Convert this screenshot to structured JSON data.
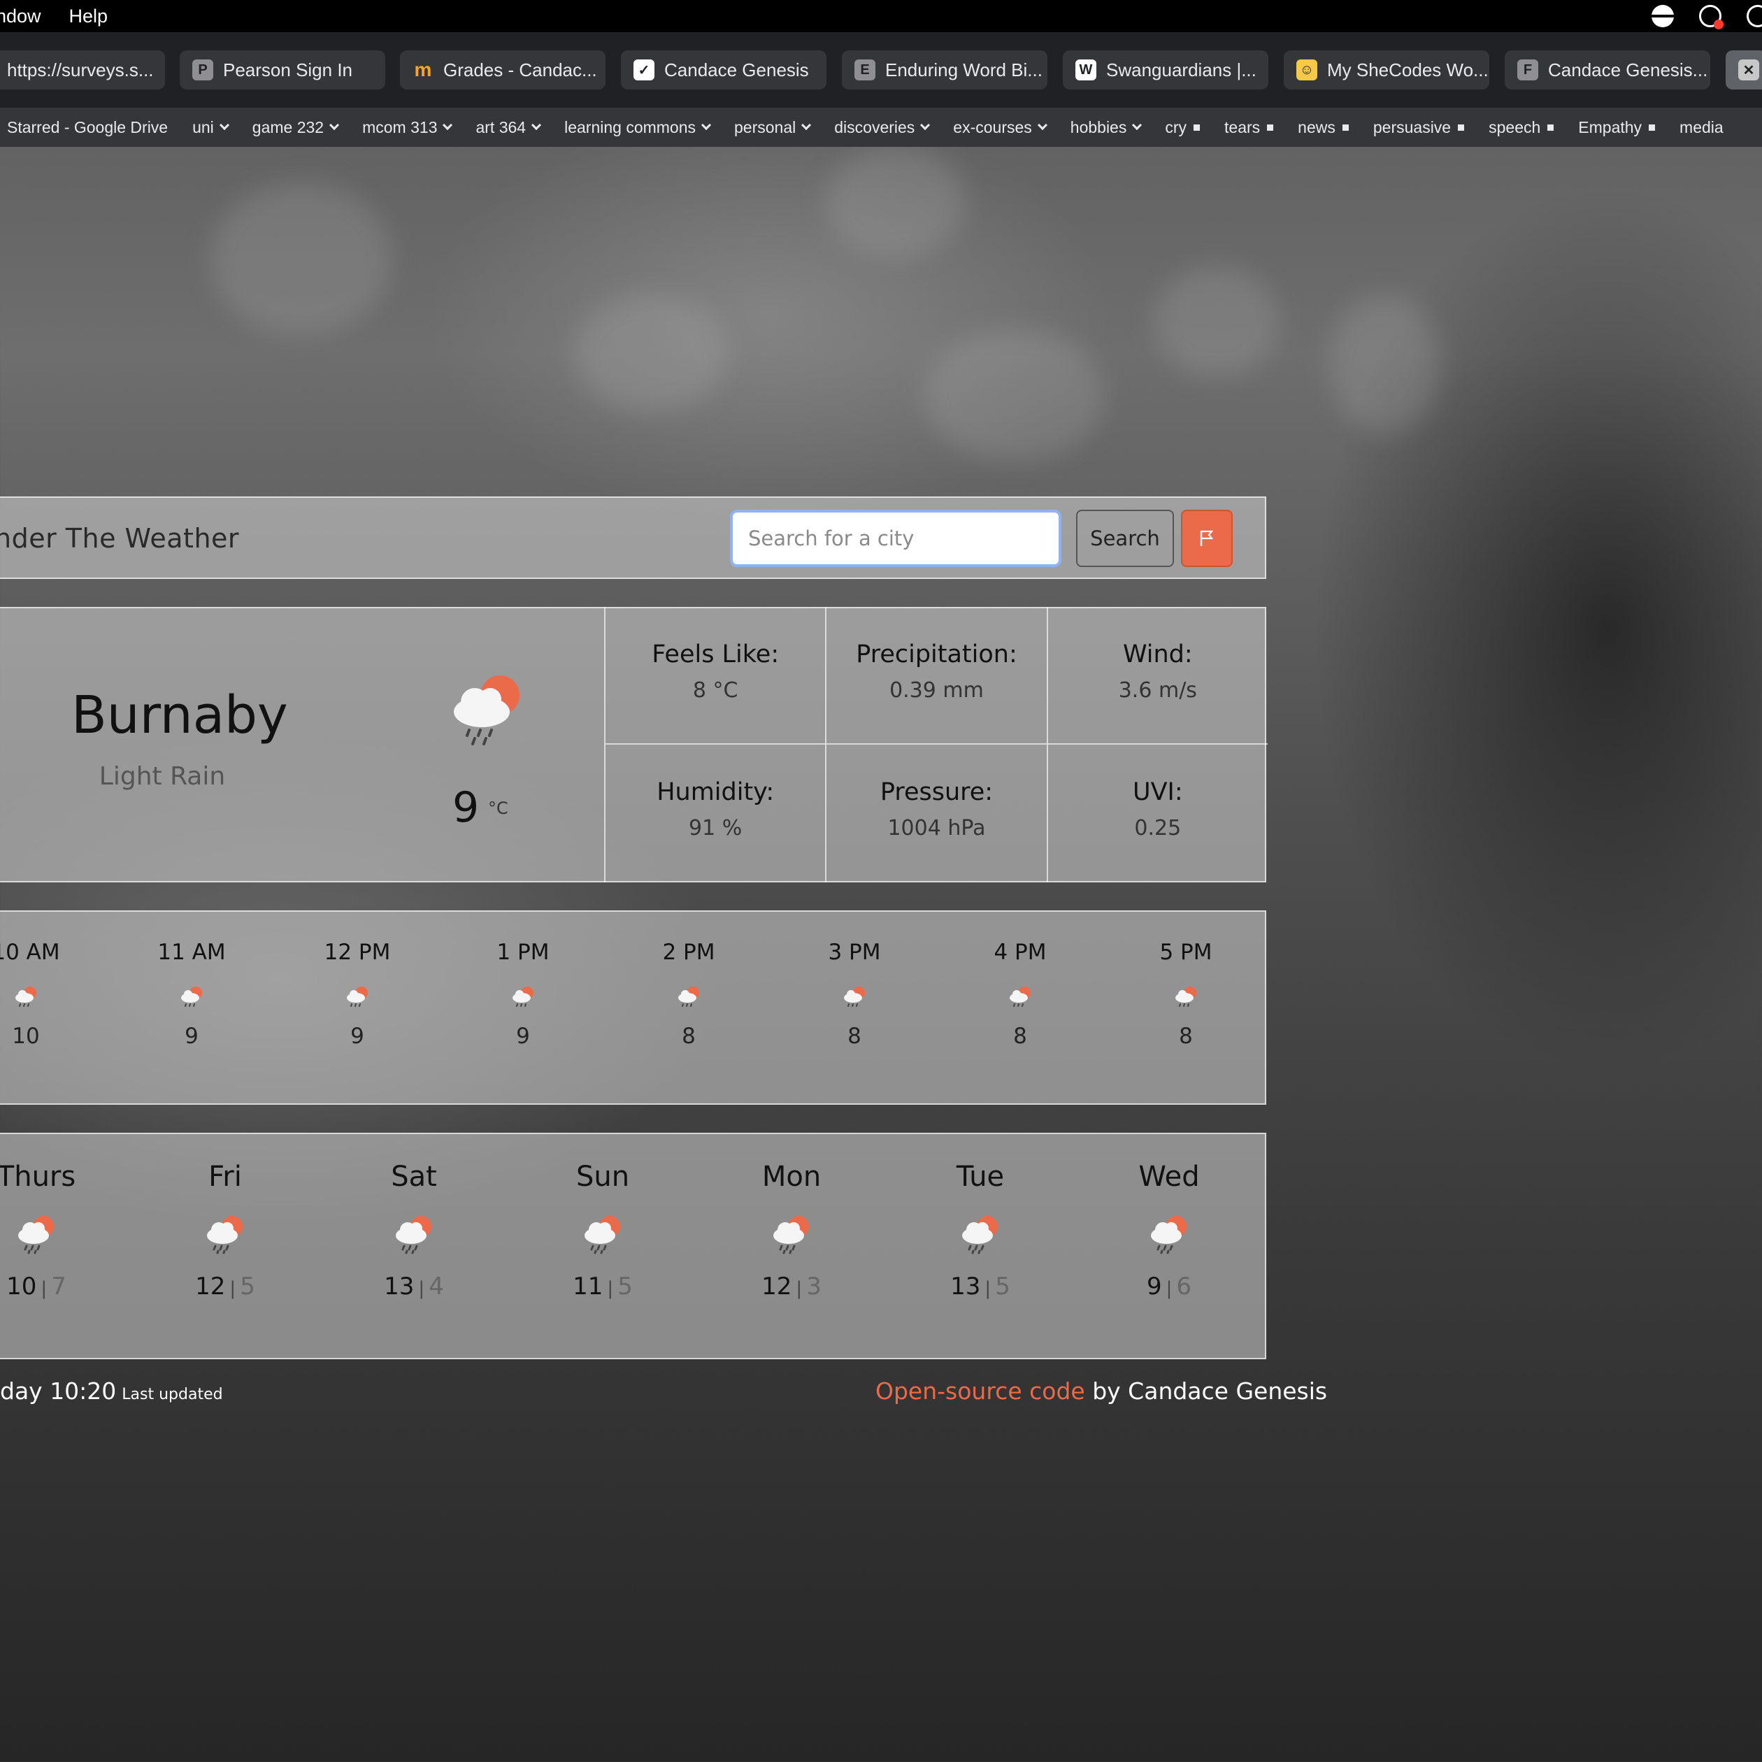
{
  "menubar": {
    "items": [
      "ndow",
      "Help"
    ]
  },
  "tabs": [
    {
      "label": "https://surveys.s...",
      "favicon": ""
    },
    {
      "label": "Pearson Sign In",
      "favicon": "P"
    },
    {
      "label": "Grades - Candac...",
      "favicon": "m"
    },
    {
      "label": "Candace Genesis",
      "favicon": "✓"
    },
    {
      "label": "Enduring Word Bi...",
      "favicon": "E"
    },
    {
      "label": "Swanguardians |...",
      "favicon": "W"
    },
    {
      "label": "My SheCodes Wo...",
      "favicon": "☺"
    },
    {
      "label": "Candace Genesis...",
      "favicon": "F"
    },
    {
      "label": "",
      "favicon": "✕"
    }
  ],
  "bookmarks": [
    {
      "label": "Starred - Google Drive",
      "type": "link"
    },
    {
      "label": "uni",
      "type": "folder"
    },
    {
      "label": "game 232",
      "type": "folder"
    },
    {
      "label": "mcom 313",
      "type": "folder"
    },
    {
      "label": "art 364",
      "type": "folder"
    },
    {
      "label": "learning commons",
      "type": "folder"
    },
    {
      "label": "personal",
      "type": "folder"
    },
    {
      "label": "discoveries",
      "type": "folder"
    },
    {
      "label": "ex-courses",
      "type": "folder"
    },
    {
      "label": "hobbies",
      "type": "folder"
    },
    {
      "label": "cry",
      "type": "square"
    },
    {
      "label": "tears",
      "type": "square"
    },
    {
      "label": "news",
      "type": "square"
    },
    {
      "label": "persuasive",
      "type": "square"
    },
    {
      "label": "speech",
      "type": "square"
    },
    {
      "label": "Empathy",
      "type": "square"
    },
    {
      "label": "media",
      "type": "link"
    }
  ],
  "app": {
    "title": "nder The Weather",
    "search_placeholder": "Search for a city",
    "search_label": "Search",
    "accent": "#ea6a4a"
  },
  "current": {
    "city": "Burnaby",
    "description": "Light Rain",
    "temp": "9",
    "unit": "°C",
    "icon": "sun-cloud-rain-icon",
    "details": [
      {
        "label": "Feels Like:",
        "value": "8 °C"
      },
      {
        "label": "Precipitation:",
        "value": "0.39 mm"
      },
      {
        "label": "Wind:",
        "value": "3.6 m/s"
      },
      {
        "label": "Humidity:",
        "value": "91 %"
      },
      {
        "label": "Pressure:",
        "value": "1004 hPa"
      },
      {
        "label": "UVI:",
        "value": "0.25"
      }
    ]
  },
  "hourly": [
    {
      "time": "10 AM",
      "temp": "10"
    },
    {
      "time": "11 AM",
      "temp": "9"
    },
    {
      "time": "12 PM",
      "temp": "9"
    },
    {
      "time": "1 PM",
      "temp": "9"
    },
    {
      "time": "2 PM",
      "temp": "8"
    },
    {
      "time": "3 PM",
      "temp": "8"
    },
    {
      "time": "4 PM",
      "temp": "8"
    },
    {
      "time": "5 PM",
      "temp": "8"
    }
  ],
  "daily": [
    {
      "day": "Thurs",
      "max": "10",
      "min": "7"
    },
    {
      "day": "Fri",
      "max": "12",
      "min": "5"
    },
    {
      "day": "Sat",
      "max": "13",
      "min": "4"
    },
    {
      "day": "Sun",
      "max": "11",
      "min": "5"
    },
    {
      "day": "Mon",
      "max": "12",
      "min": "3"
    },
    {
      "day": "Tue",
      "max": "13",
      "min": "5"
    },
    {
      "day": "Wed",
      "max": "9",
      "min": "6"
    }
  ],
  "footer": {
    "updated_time": "day 10:20",
    "updated_label": "Last updated",
    "link_text": "Open-source code",
    "byline": " by Candace Genesis"
  }
}
